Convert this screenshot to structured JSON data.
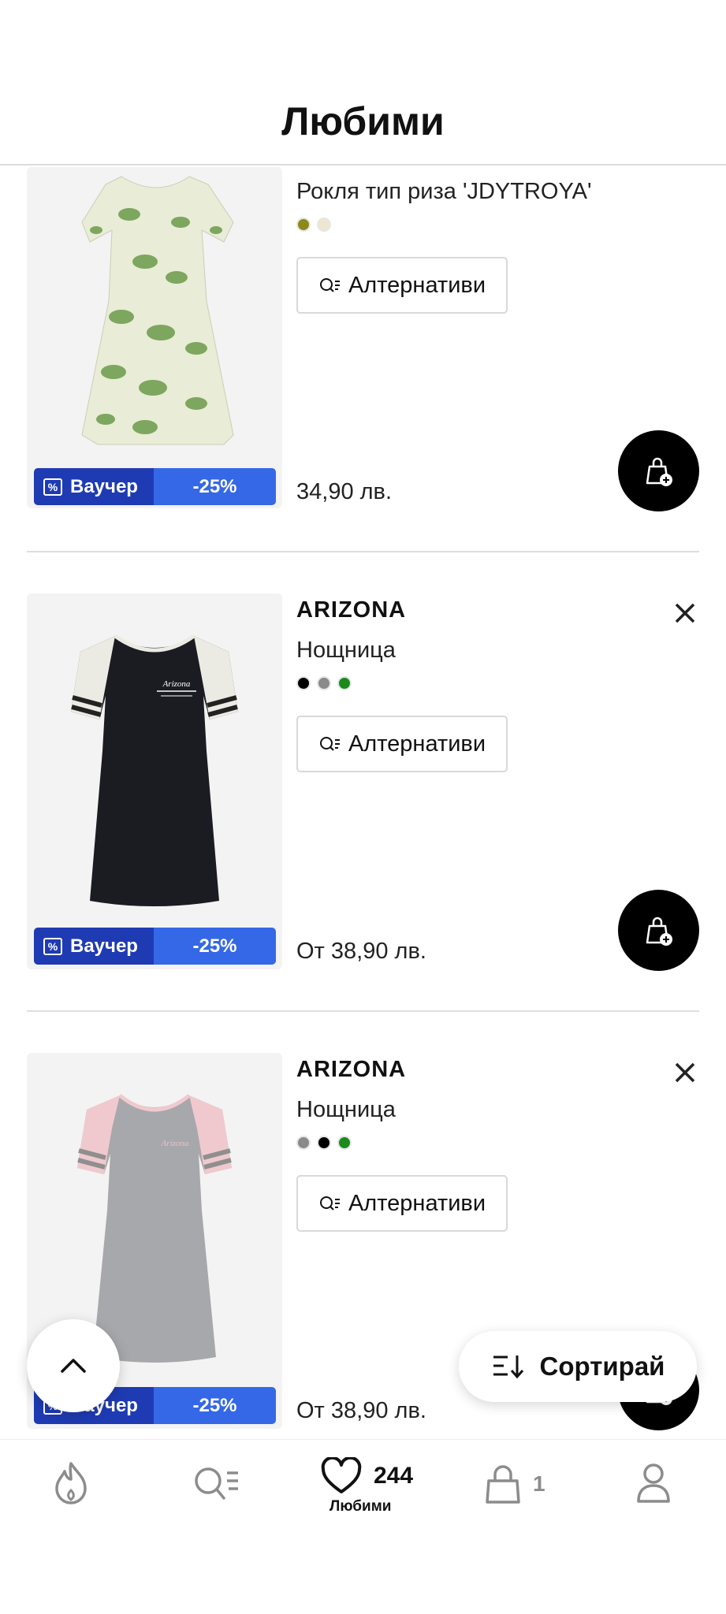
{
  "header": {
    "title": "Любими"
  },
  "products": [
    {
      "brand": "",
      "name": "Рокля тип риза 'JDYTROYA'",
      "swatches": [
        "#8a8a1a",
        "#efe6d2"
      ],
      "alt_label": "Алтернативи",
      "voucher_label": "Ваучер",
      "discount": "-25%",
      "price": "34,90 лв."
    },
    {
      "brand": "ARIZONA",
      "name": "Нощница",
      "swatches": [
        "#000000",
        "#8a8a8a",
        "#1b8a1b"
      ],
      "alt_label": "Алтернативи",
      "voucher_label": "Ваучер",
      "discount": "-25%",
      "price": "От 38,90 лв."
    },
    {
      "brand": "ARIZONA",
      "name": "Нощница",
      "swatches": [
        "#8a8a8a",
        "#000000",
        "#1b8a1b"
      ],
      "alt_label": "Алтернативи",
      "voucher_label": "Ваучер",
      "discount": "-25%",
      "price": "От 38,90 лв."
    }
  ],
  "sort": {
    "label": "Сортирай"
  },
  "nav": {
    "favorites_count": "244",
    "favorites_label": "Любими",
    "cart_count": "1",
    "icons": [
      "flame-icon",
      "search-list-icon",
      "heart-icon",
      "shopping-bag-icon",
      "user-icon"
    ]
  },
  "colors": {
    "voucher_dark": "#1f3bb3",
    "voucher_light": "#3568e6",
    "button_black": "#000000"
  }
}
